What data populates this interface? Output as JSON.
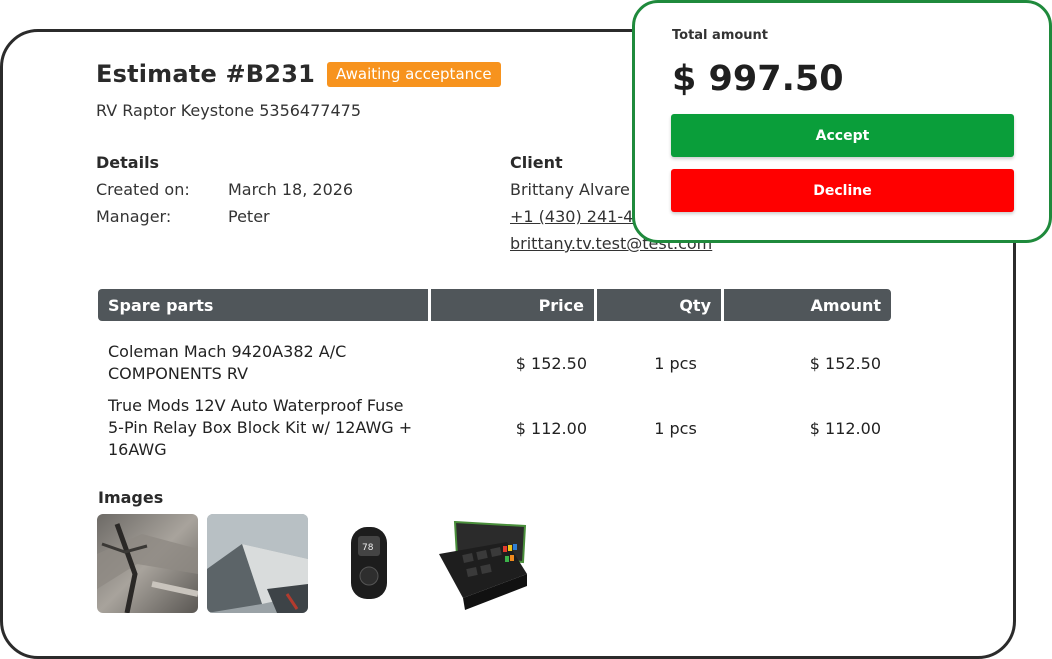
{
  "estimate": {
    "title": "Estimate #B231",
    "status": "Awaiting acceptance",
    "vehicle": "RV Raptor Keystone 5356477475"
  },
  "details": {
    "heading": "Details",
    "created_label": "Created on:",
    "created_value": "March 18, 2026",
    "manager_label": "Manager:",
    "manager_value": "Peter"
  },
  "client": {
    "heading": "Client",
    "name": "Brittany Alvare",
    "phone": "+1 (430) 241-47",
    "email": "brittany.tv.test@test.com"
  },
  "parts_table": {
    "headers": [
      "Spare parts",
      "Price",
      "Qty",
      "Amount"
    ],
    "rows": [
      {
        "name": "Coleman Mach 9420A382 A/C COMPONENTS RV",
        "price": "$ 152.50",
        "qty": "1 pcs",
        "amount": "$ 152.50"
      },
      {
        "name": "True Mods 12V Auto Waterproof Fuse 5-Pin Relay Box Block Kit w/ 12AWG + 16AWG",
        "price": "$ 112.00",
        "qty": "1 pcs",
        "amount": "$ 112.00"
      }
    ]
  },
  "images": {
    "heading": "Images",
    "items": [
      "rv-damage-photo-icon",
      "rv-panel-photo-icon",
      "thermostat-control-icon",
      "relay-box-kit-icon"
    ]
  },
  "total": {
    "label": "Total amount",
    "value": "$ 997.50",
    "accept_label": "Accept",
    "decline_label": "Decline"
  },
  "colors": {
    "status_badge": "#f7931e",
    "accept": "#0a9e3a",
    "decline": "#ff0000",
    "panel_border": "#1f8a3c",
    "table_header": "#50565a"
  }
}
